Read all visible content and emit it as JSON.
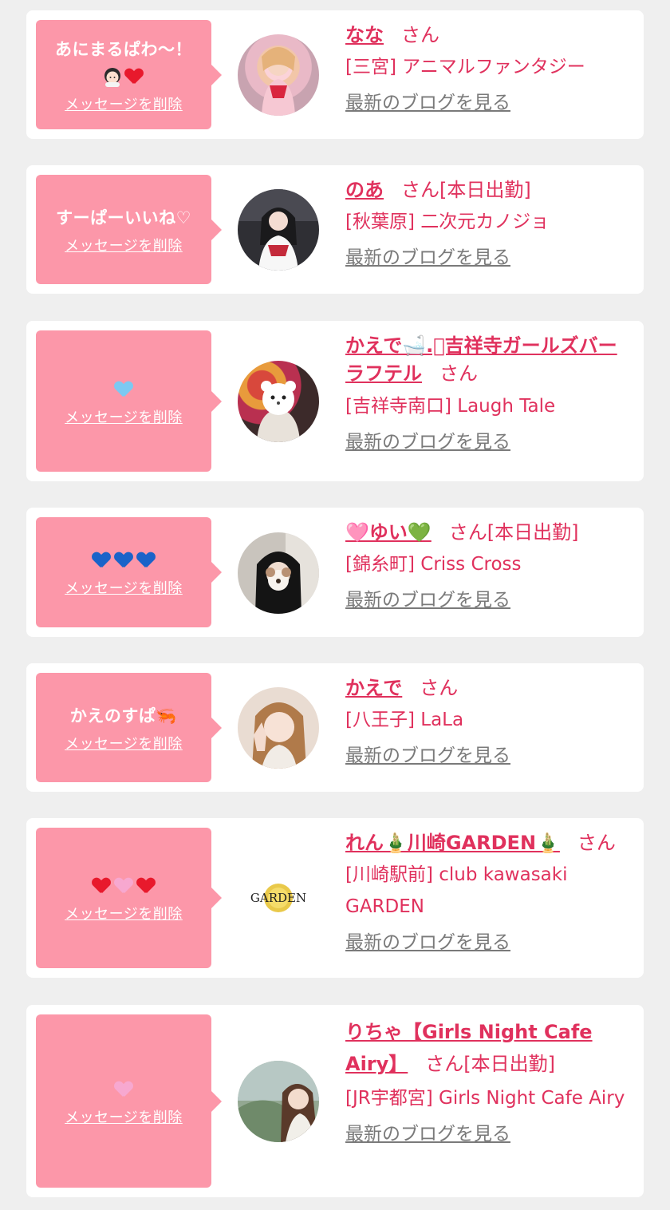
{
  "delete_label": "メッセージを削除",
  "blog_label": "最新のブログを見る",
  "colors": {
    "accent": "#e0315d",
    "bubble": "#fc97a9",
    "background": "#efefef"
  },
  "cards": [
    {
      "message": "あにまるぱわ〜！",
      "message_emoji": [
        "girl-emoji",
        "red-heart"
      ],
      "name": "なな",
      "suffix": "さん",
      "shop": "[三宮] アニマルファンタジー",
      "avatar_icon": "profile-photo"
    },
    {
      "message": "すーぱーいいね♡",
      "message_emoji": [],
      "name": "のあ",
      "suffix": "さん[本日出勤]",
      "shop": "[秋葉原] 二次元カノジョ",
      "avatar_icon": "profile-photo"
    },
    {
      "message": "",
      "message_emoji": [
        "light-blue-heart"
      ],
      "name": "かえで🛁.ﾟ吉祥寺ガールズバーラフテル",
      "suffix": "さん",
      "shop": "[吉祥寺南口] Laugh Tale",
      "avatar_icon": "profile-photo"
    },
    {
      "message": "",
      "message_emoji": [
        "blue-heart",
        "blue-heart",
        "blue-heart"
      ],
      "name": "🩷ゆい💚",
      "suffix": "さん[本日出勤]",
      "shop": "[錦糸町] Criss Cross",
      "avatar_icon": "profile-photo"
    },
    {
      "message": "かえのすぱ🦐",
      "message_emoji": [],
      "name": "かえで",
      "suffix": "さん",
      "shop": "[八王子] LaLa",
      "avatar_icon": "profile-photo"
    },
    {
      "message": "",
      "message_emoji": [
        "red-heart",
        "pink-heart",
        "red-heart"
      ],
      "name": "れん🎍川崎GARDEN🎍",
      "suffix": "さん",
      "shop": "[川崎駅前] club kawasaki GARDEN",
      "avatar_icon": "garden-logo",
      "avatar_logo_text": "GARDEN"
    },
    {
      "message": "",
      "message_emoji": [
        "pink-heart"
      ],
      "name": "りちゃ【Girls Night Cafe Airy】",
      "suffix": "さん[本日出勤]",
      "shop": "[JR宇都宮] Girls Night Cafe Airy",
      "avatar_icon": "profile-photo"
    }
  ]
}
